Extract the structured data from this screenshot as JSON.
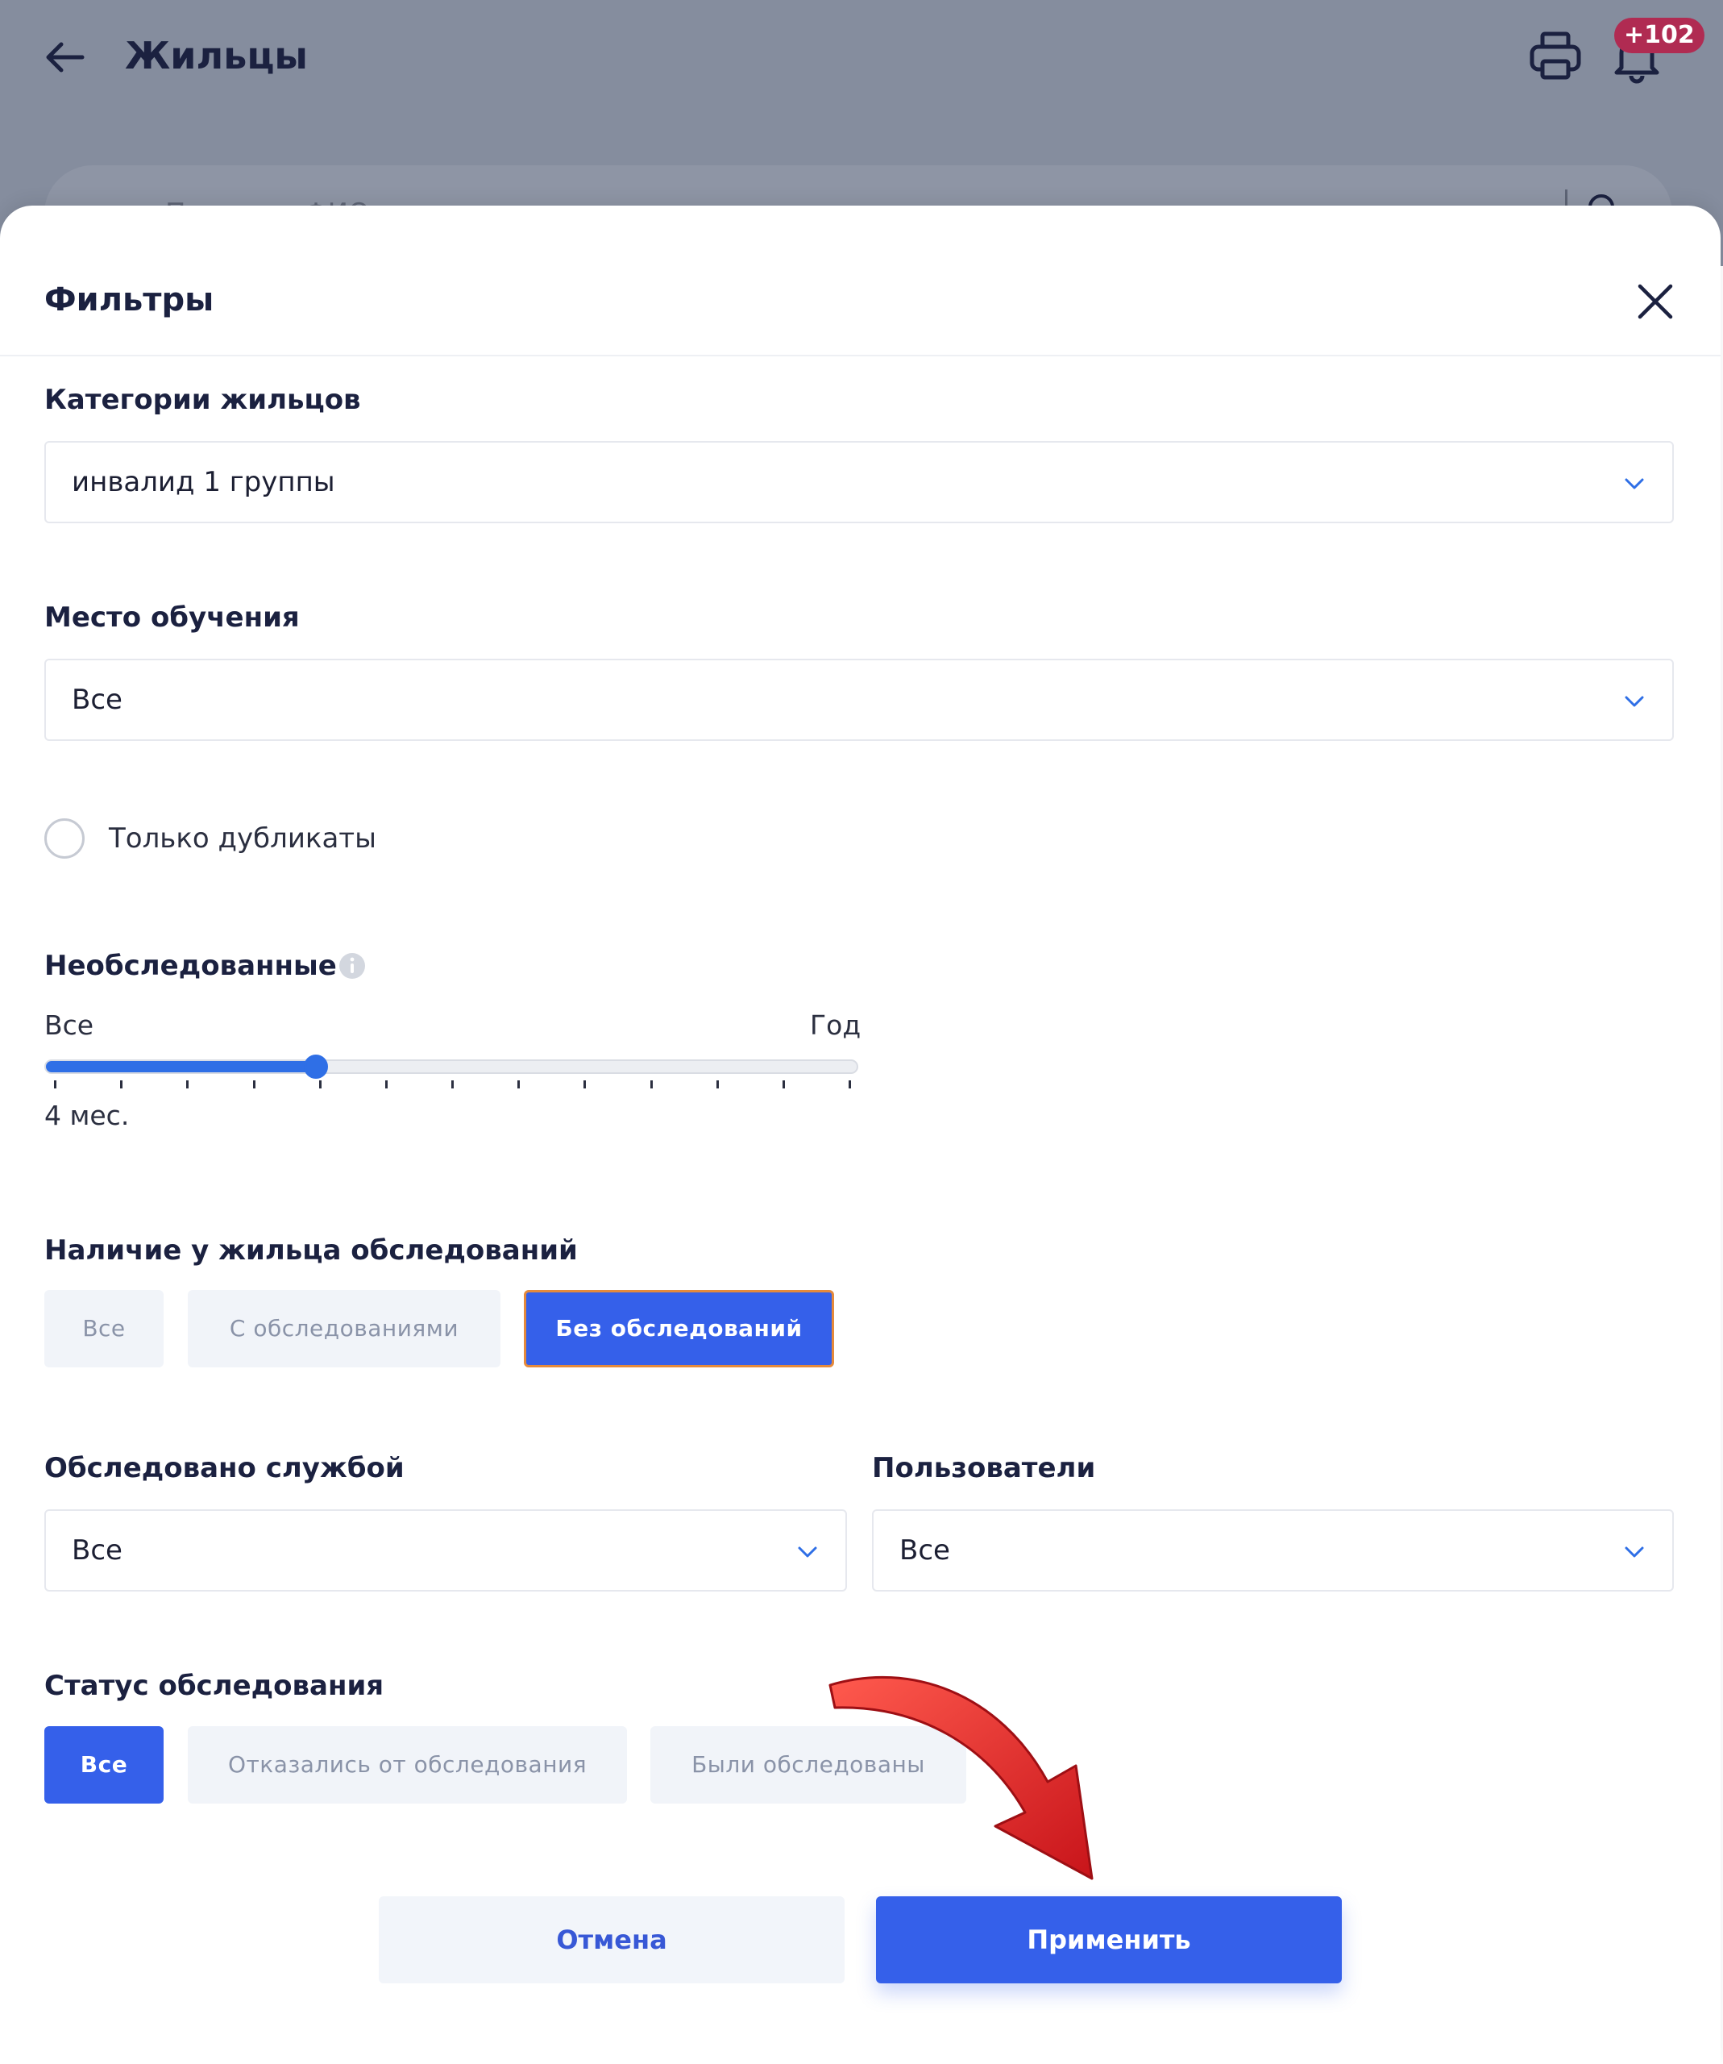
{
  "header": {
    "title": "Жильцы",
    "notifications_badge": "+102",
    "search_placeholder": "Поиск по ФИО"
  },
  "filters": {
    "title": "Фильтры",
    "resident_categories": {
      "label": "Категории жильцов",
      "value": "инвалид 1 группы"
    },
    "study_place": {
      "label": "Место обучения",
      "value": "Все"
    },
    "duplicates_only": {
      "label": "Только дубликаты",
      "checked": false
    },
    "unexamined": {
      "label": "Необследованные",
      "min_label": "Все",
      "max_label": "Год",
      "value_label": "4 мес.",
      "value_fraction": 0.3333,
      "tick_count": 13
    },
    "examinations_presence": {
      "label": "Наличие у жильца обследований",
      "options": [
        "Все",
        "С обследованиями",
        "Без обследований"
      ],
      "selected": "Без обследований"
    },
    "examined_by_service": {
      "label": "Обследовано службой",
      "value": "Все"
    },
    "users": {
      "label": "Пользователи",
      "value": "Все"
    },
    "examination_status": {
      "label": "Статус обследования",
      "options": [
        "Все",
        "Отказались от обследования",
        "Были обследованы"
      ],
      "selected": "Все"
    },
    "cancel_label": "Отмена",
    "apply_label": "Применить"
  },
  "colors": {
    "accent": "#3560ea",
    "slider": "#2f6fe6",
    "badge": "#b02b52",
    "annotation_arrow": "#d8231f",
    "focus_outline": "#e58a3c"
  }
}
